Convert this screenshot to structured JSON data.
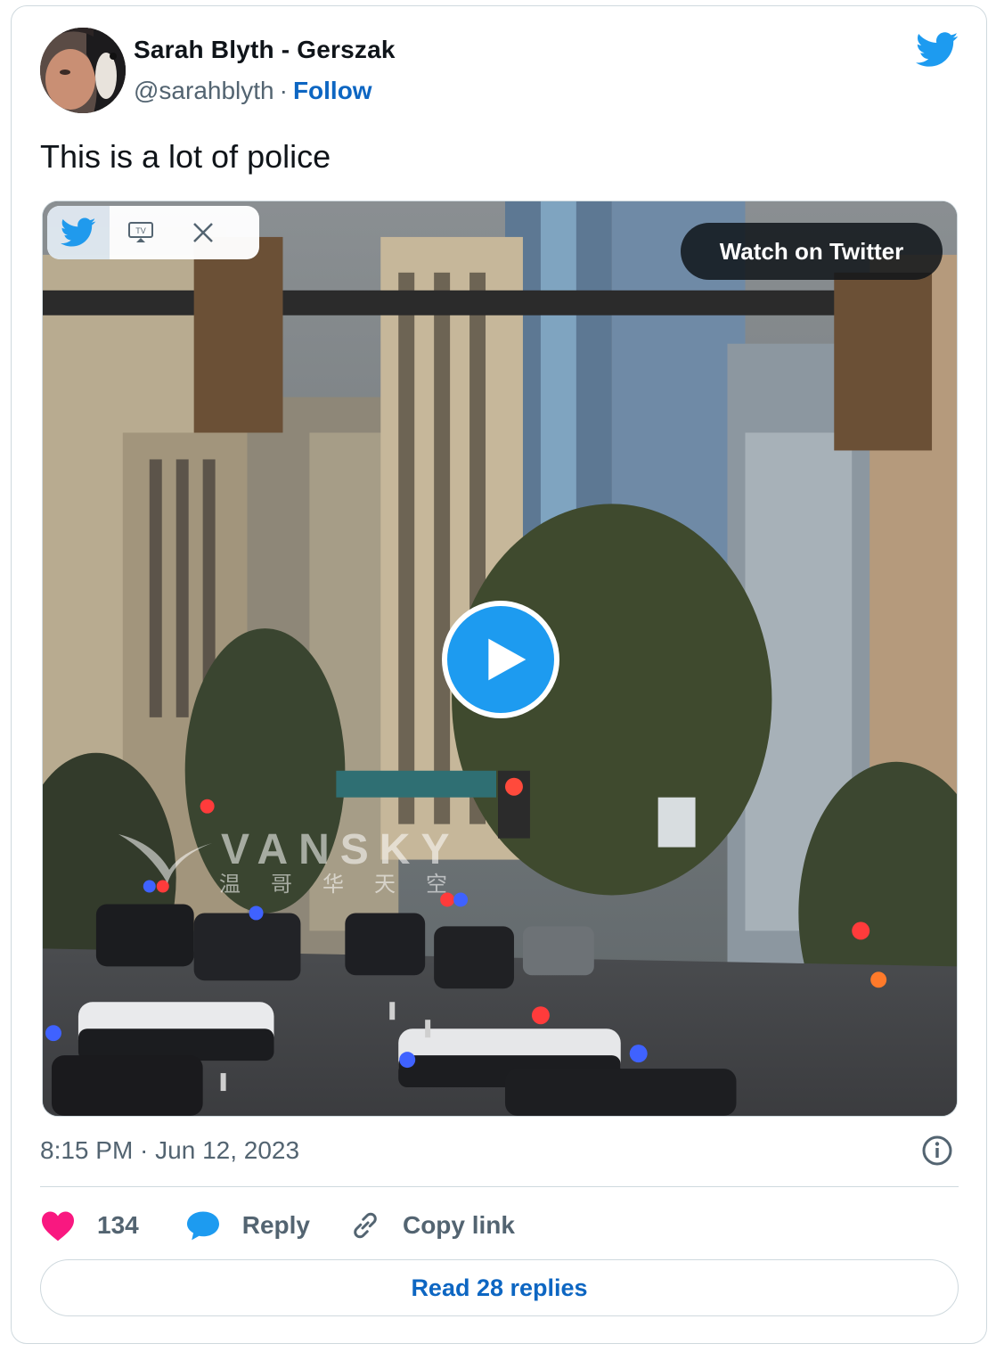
{
  "author": {
    "name": "Sarah Blyth - Gerszak",
    "handle": "@sarahblyth",
    "separator": "·",
    "follow_label": "Follow"
  },
  "tweet": {
    "text": "This is a lot of police",
    "timestamp": "8:15 PM · Jun 12, 2023"
  },
  "media": {
    "watch_label": "Watch on Twitter",
    "watermark_title": "VANSKY",
    "watermark_sub": "温哥华天空",
    "toolbar_icons": [
      "bird-icon",
      "tv-icon",
      "close-icon"
    ]
  },
  "actions": {
    "like_count": "134",
    "reply_label": "Reply",
    "copy_label": "Copy link",
    "read_replies_label": "Read 28 replies"
  },
  "colors": {
    "twitter_blue": "#1d9bf0",
    "link_blue": "#0d66c2",
    "heart": "#f91880",
    "muted": "#536471"
  }
}
